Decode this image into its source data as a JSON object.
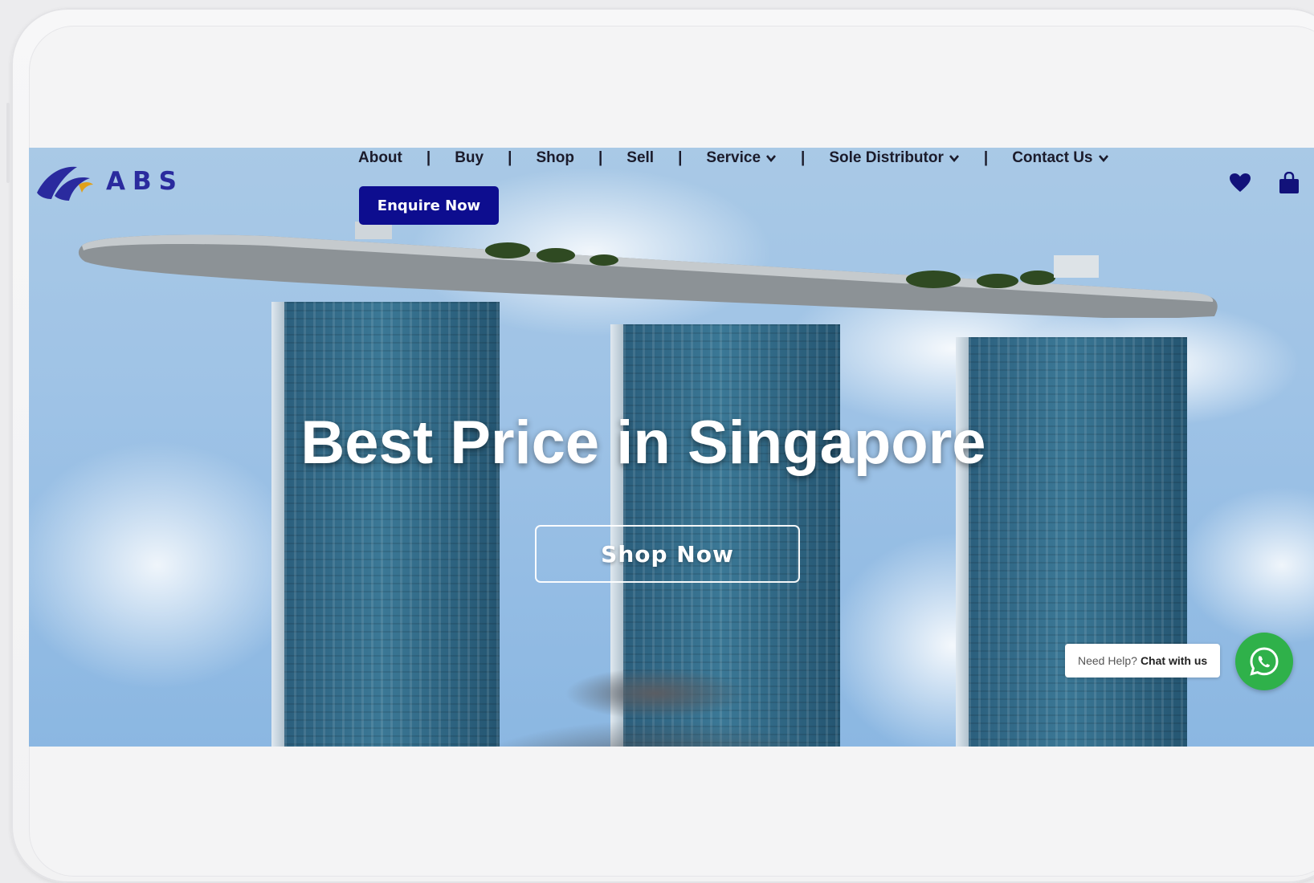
{
  "header": {
    "logo_text": "ABS",
    "nav": [
      {
        "label": "About",
        "dropdown": false
      },
      {
        "label": "Buy",
        "dropdown": false
      },
      {
        "label": "Shop",
        "dropdown": false
      },
      {
        "label": "Sell",
        "dropdown": false
      },
      {
        "label": "Service",
        "dropdown": true
      },
      {
        "label": "Sole Distributor",
        "dropdown": true
      },
      {
        "label": "Contact Us",
        "dropdown": true
      }
    ],
    "separator": "|",
    "enquire_label": "Enquire Now",
    "icons": [
      "heart-icon",
      "shopping-bag-icon"
    ]
  },
  "hero": {
    "title": "Best Price in Singapore",
    "cta_label": "Shop Now"
  },
  "chat": {
    "prompt": "Need Help?",
    "action": "Chat with us",
    "icon": "whatsapp-icon"
  },
  "colors": {
    "brand_navy": "#0d0d8f",
    "logo_blue": "#2a2a9e",
    "whatsapp_green": "#2fb14a"
  }
}
